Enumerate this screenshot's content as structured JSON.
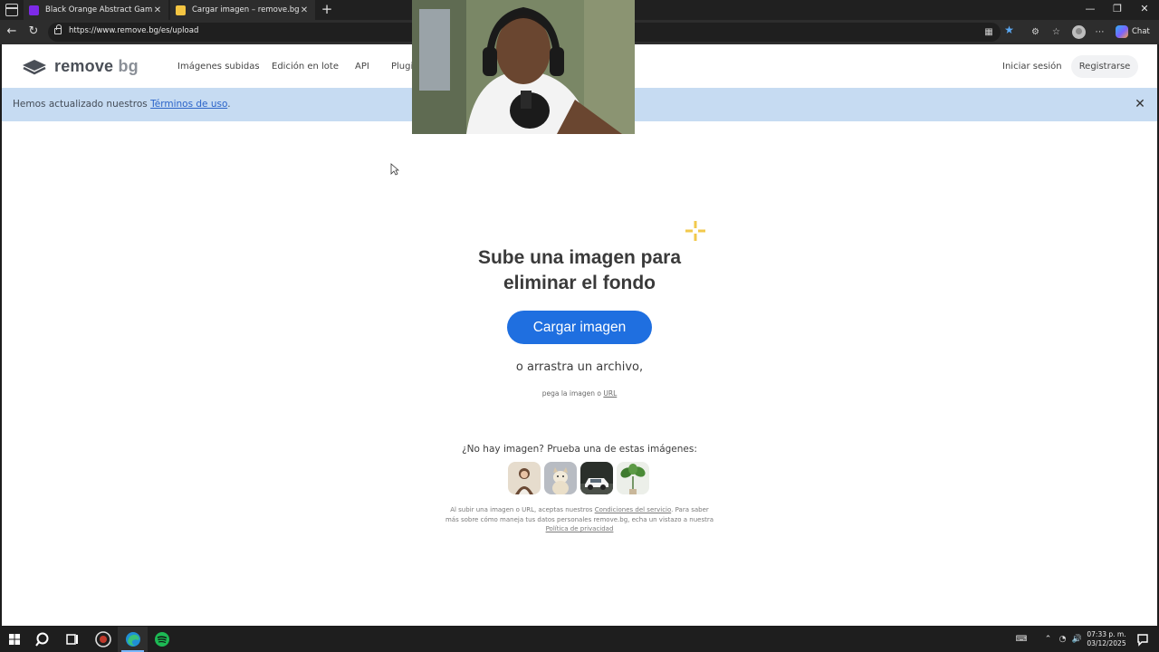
{
  "browser": {
    "tabs": [
      {
        "title": "Black Orange Abstract Gaming Tw",
        "active": false
      },
      {
        "title": "Cargar imagen – remove.bg",
        "active": true
      }
    ],
    "url": "https://www.remove.bg/es/upload",
    "chat_label": "Chat"
  },
  "site": {
    "logo_main": "remove",
    "logo_suffix": "bg",
    "nav": [
      "Imágenes subidas",
      "Edición en lote",
      "API",
      "Plugi"
    ],
    "login": "Iniciar sesión",
    "signup": "Registrarse"
  },
  "notice": {
    "text": "Hemos actualizado nuestros ",
    "link": "Términos de uso",
    "end": "."
  },
  "hero": {
    "title_line1": "Sube una imagen para",
    "title_line2": "eliminar el fondo",
    "upload_button": "Cargar imagen",
    "drag_text": "o arrastra un archivo,",
    "paste_text": "pega la imagen o ",
    "paste_url": "URL"
  },
  "samples": {
    "prompt": "¿No hay imagen? Prueba una de estas imágenes:",
    "items": [
      "woman-sample",
      "dog-sample",
      "car-sample",
      "plant-sample"
    ]
  },
  "legal": {
    "p1": "Al subir una imagen o URL, aceptas nuestros ",
    "terms": "Condiciones del servicio",
    "p2": ". Para saber más sobre cómo maneja tus datos personales remove.bg, echa un vistazo a nuestra ",
    "privacy": "Política de privacidad"
  },
  "taskbar": {
    "time": "07:33 p. m.",
    "date": "03/12/2025"
  },
  "colors": {
    "accent": "#1f6fe0",
    "notice_bg": "#c6dbf2",
    "sparkle": "#f2c94c"
  }
}
